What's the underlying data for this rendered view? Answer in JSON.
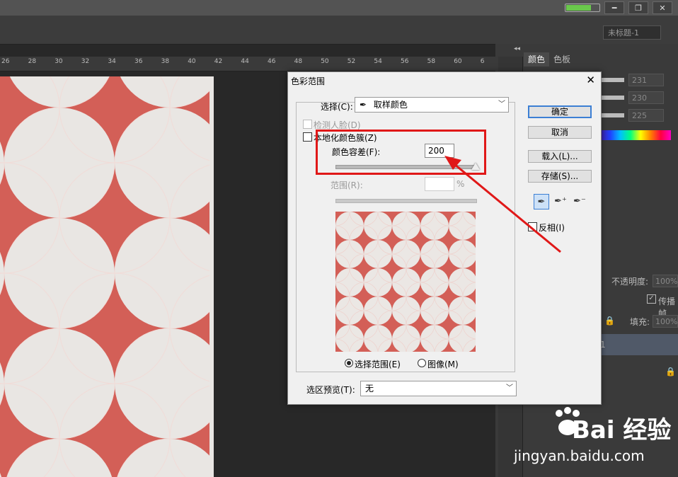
{
  "document": {
    "tab_title": "未标题-1"
  },
  "battery_level": 0.75,
  "ruler": {
    "ticks": [
      "26",
      "28",
      "30",
      "32",
      "34",
      "36",
      "38",
      "40",
      "42",
      "44",
      "46",
      "48",
      "50",
      "52",
      "54",
      "56",
      "58",
      "60",
      "6"
    ]
  },
  "panels": {
    "tabs": [
      "颜色",
      "色板"
    ],
    "color_values": [
      "231",
      "230",
      "225"
    ],
    "opacity_label": "不透明度:",
    "opacity_value": "100%",
    "spread_label": "传播帧",
    "fill_label": "填充:",
    "fill_value": "100%",
    "layer_char": "1",
    "collapse_glyph": "◂◂"
  },
  "dialog": {
    "title": "色彩范围",
    "select_label": "选择(C):",
    "select_value": "取样颜色",
    "detect_faces": "检测人脸(D)",
    "localized": "本地化颜色簇(Z)",
    "fuzziness_label": "颜色容差(F):",
    "fuzziness_value": "200",
    "fuzziness_level": 1.0,
    "range_label": "范围(R):",
    "range_unit": "%",
    "radio_selection": "选择范围(E)",
    "radio_image": "图像(M)",
    "preview_label": "选区预览(T):",
    "preview_value": "无",
    "buttons": {
      "ok": "确定",
      "cancel": "取消",
      "load": "载入(L)...",
      "save": "存储(S)..."
    },
    "invert": "反相(I)"
  },
  "watermark": {
    "brand": "Bai  经验",
    "url": "jingyan.baidu.com"
  },
  "colors": {
    "canvas_red": "#d35f57",
    "annotation_red": "#e01818"
  }
}
